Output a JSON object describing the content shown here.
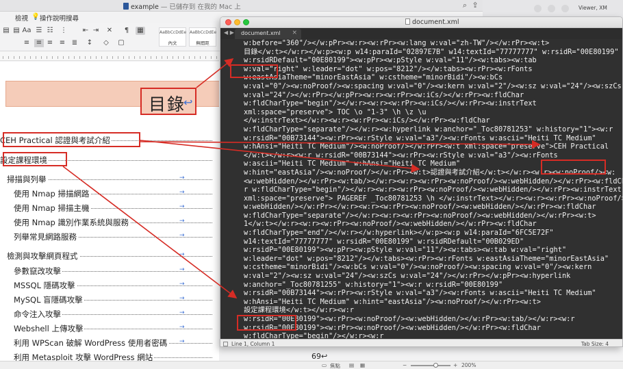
{
  "word": {
    "title": "example",
    "title_sub": " — 已儲存到 在我的 Mac 上",
    "menu": [
      "",
      "檢視",
      "操作說明搜尋"
    ],
    "menu_left": "",
    "menu_left_2": "",
    "style_gallery": [
      {
        "preview": "AaBbCcDdEe",
        "label": "內文"
      },
      {
        "preview": "AaBbCcDdEe",
        "label": "無間距"
      }
    ],
    "toc_title": "目錄",
    "toc_mark": "↩",
    "toc_entries": [
      {
        "text": "CEH Practical 認證與考試介紹",
        "level": 0
      },
      {
        "text": "設定課程環境",
        "level": 0
      },
      {
        "text": "掃描與列舉",
        "level": 1
      },
      {
        "text": "使用 Nmap 掃描網路",
        "level": 2
      },
      {
        "text": "使用 Nmap 掃描主機",
        "level": 2
      },
      {
        "text": "使用 Nmap 識別作業系統與服務",
        "level": 2
      },
      {
        "text": "列舉常見網路服務",
        "level": 2
      },
      {
        "text": "檢測與攻擊網頁程式",
        "level": 1
      },
      {
        "text": "參數竄改攻擊",
        "level": 2
      },
      {
        "text": "MSSQL 隱碼攻擊",
        "level": 2
      },
      {
        "text": "MySQL 盲隱碼攻擊",
        "level": 2
      },
      {
        "text": "命令注入攻擊",
        "level": 2
      },
      {
        "text": "Webshell 上傳攻擊",
        "level": 2
      },
      {
        "text": "利用 WPScan 破解 WordPress 使用者密碼",
        "level": 2
      },
      {
        "text": "利用 Metasploit 攻擊 WordPress 網站",
        "level": 2,
        "page": "69↩"
      }
    ],
    "status": {
      "focus": "焦點",
      "zoom": "200%"
    }
  },
  "bg_window_label": "Viewer, XM",
  "editor": {
    "title": "document.xml",
    "tab": "document.xml",
    "status_position": "Line 1, Column 1",
    "status_tabsize": "Tab Size: 4",
    "code_lines": [
      "w:before=\"360\"/></w:pPr><w:r><w:rPr><w:lang w:val=\"zh-TW\"/></w:rPr><w:t>",
      "目錄</w:t></w:r></w:p><w:p w14:paraId=\"02897E7B\" w14:textId=\"77777777\" w:rsidR=\"00E80199\"",
      "w:rsidRDefault=\"00E80199\"><w:pPr><w:pStyle w:val=\"11\"/><w:tabs><w:tab",
      "w:val=\"right\" w:leader=\"dot\" w:pos=\"8212\"/></w:tabs><w:rPr><w:rFonts",
      "w:eastAsiaTheme=\"minorEastAsia\" w:cstheme=\"minorBidi\"/><w:bCs",
      "w:val=\"0\"/><w:noProof/><w:spacing w:val=\"0\"/><w:kern w:val=\"2\"/><w:sz w:val=\"24\"/><w:szCs",
      "w:val=\"24\"/></w:rPr></w:pPr><w:r><w:rPr><w:iCs/></w:rPr><w:fldChar",
      "w:fldCharType=\"begin\"/></w:r><w:r><w:rPr><w:iCs/></w:rPr><w:instrText",
      "xml:space=\"preserve\"> TOC \\o \"1-3\" \\h \\z \\u",
      "</w:instrText></w:r><w:r><w:rPr><w:iCs/></w:rPr><w:fldChar",
      "w:fldCharType=\"separate\"/></w:r><w:hyperlink w:anchor=\"_Toc80781253\" w:history=\"1\"><w:r",
      "w:rsidR=\"00B73144\"><w:rPr><w:rStyle w:val=\"a3\"/><w:rFonts w:ascii=\"Heiti TC Medium\"",
      "w:hAnsi=\"Heiti TC Medium\"/><w:noProof/></w:rPr><w:t xml:space=\"preserve\">CEH Practical",
      "</w:t></w:r><w:r w:rsidR=\"00B73144\"><w:rPr><w:rStyle w:val=\"a3\"/><w:rFonts",
      "w:ascii=\"Heiti TC Medium\" w:hAnsi=\"Heiti TC Medium\"",
      "w:hint=\"eastAsia\"/><w:noProof/></w:rPr><w:t>認證與考試介紹</w:t></w:r><w:r><w:noProof/><w:",
      "<w:webHidden/></w:rPr><w:tab/></w:r><w:r><w:rPr><w:noProof/><w:webHidden/></w:rPr><w:fldCha",
      "r w:fldCharType=\"begin\"/></w:r><w:r><w:rPr><w:noProof/><w:webHidden/></w:rPr><w:instrText",
      "xml:space=\"preserve\"> PAGEREF _Toc80781253 \\h </w:instrText></w:r><w:r><w:rPr><w:noProof/><",
      "w:webHidden/></w:rPr></w:r><w:r><w:rPr><w:noProof/><w:webHidden/></w:rPr><w:fldChar",
      "w:fldCharType=\"separate\"/></w:r><w:r><w:rPr><w:noProof/><w:webHidden/></w:rPr><w:t>",
      "1</w:t></w:r><w:r><w:rPr><w:noProof/><w:webHidden/></w:rPr><w:fldChar",
      "w:fldCharType=\"end\"/></w:r></w:hyperlink></w:p><w:p w14:paraId=\"6FC5E72F\"",
      "w14:textId=\"77777777\" w:rsidR=\"00E80199\" w:rsidRDefault=\"00B029ED\"",
      "w:rsidP=\"00E80199\"><w:pPr><w:pStyle w:val=\"11\"/><w:tabs><w:tab w:val=\"right\"",
      "w:leader=\"dot\" w:pos=\"8212\"/></w:tabs><w:rPr><w:rFonts w:eastAsiaTheme=\"minorEastAsia\"",
      "w:cstheme=\"minorBidi\"/><w:bCs w:val=\"0\"/><w:noProof/><w:spacing w:val=\"0\"/><w:kern",
      "w:val=\"2\"/><w:sz w:val=\"24\"/><w:szCs w:val=\"24\"/></w:rPr></w:pPr><w:hyperlink",
      "w:anchor=\"_Toc80781255\" w:history=\"1\"><w:r w:rsidR=\"00E80199\"",
      "w:rsidR=\"00B73144\"><w:rPr><w:rStyle w:val=\"a3\"/><w:rFonts w:ascii=\"Heiti TC Medium\"",
      "w:hAnsi=\"Heiti TC Medium\" w:hint=\"eastAsia\"/><w:noProof/></w:rPr><w:t>",
      "設定課程環境</w:t></w:r><w:r",
      "w:rsidR=\"00E80199\"><w:rPr><w:noProof/><w:webHidden/></w:rPr><w:tab/></w:r><w:r",
      "w:rsidR=\"00E80199\"><w:rPr><w:noProof/><w:webHidden/></w:rPr><w:fldChar",
      "w:fldCharType=\"begin\"/></w:r><w:r",
      "w:rsidR=\"00E80199\"><w:rPr><w:noProof/><w:webHidden/></w:rPr><w:instrText"
    ]
  },
  "colors": {
    "annotation": "#d62c25",
    "editor_bg": "#303030",
    "banner": "#f5ccb9",
    "tab_arrow": "#3b6fd4"
  }
}
